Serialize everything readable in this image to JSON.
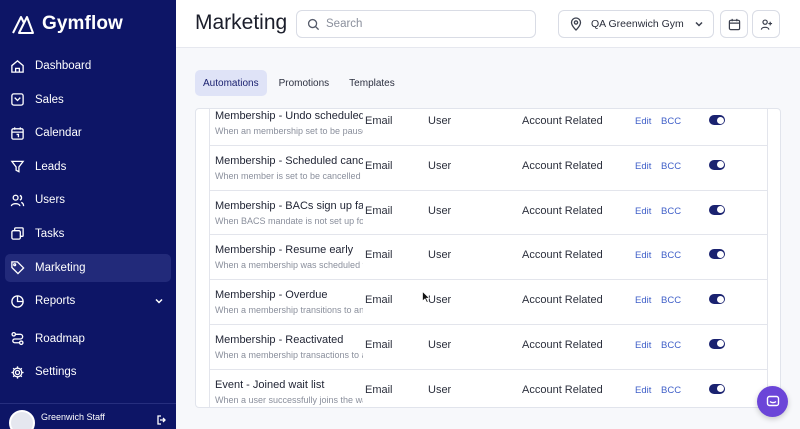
{
  "app": {
    "brand": "Gymflow"
  },
  "sidebar": {
    "items": [
      {
        "label": "Dashboard",
        "icon": "home-icon"
      },
      {
        "label": "Sales",
        "icon": "sales-icon"
      },
      {
        "label": "Calendar",
        "icon": "calendar-icon"
      },
      {
        "label": "Leads",
        "icon": "funnel-icon"
      },
      {
        "label": "Users",
        "icon": "users-icon"
      },
      {
        "label": "Tasks",
        "icon": "tasks-icon"
      },
      {
        "label": "Marketing",
        "icon": "tag-icon",
        "active": true
      },
      {
        "label": "Reports",
        "icon": "pie-chart-icon",
        "expandable": true
      },
      {
        "label": "Roadmap",
        "icon": "route-icon"
      },
      {
        "label": "Settings",
        "icon": "gear-icon"
      }
    ],
    "user": {
      "name": "Greenwich Staff"
    }
  },
  "header": {
    "title": "Marketing",
    "search_placeholder": "Search",
    "gym_selector": "QA Greenwich Gym"
  },
  "tabs": [
    {
      "label": "Automations",
      "active": true
    },
    {
      "label": "Promotions",
      "active": false
    },
    {
      "label": "Templates",
      "active": false
    }
  ],
  "table": {
    "rows": [
      {
        "title": "Membership - Undo scheduled pause",
        "desc": "When an membership set to be paused is reverted",
        "type": "Email",
        "audience": "User",
        "category": "Account Related",
        "edit": "Edit",
        "bcc": "BCC",
        "enabled": true
      },
      {
        "title": "Membership - Scheduled cancellation",
        "desc": "When member is set to be cancelled in the future",
        "type": "Email",
        "audience": "User",
        "category": "Account Related",
        "edit": "Edit",
        "bcc": "BCC",
        "enabled": true
      },
      {
        "title": "Membership - BACs sign up failure",
        "desc": "When BACS mandate is not set up for the membership",
        "type": "Email",
        "audience": "User",
        "category": "Account Related",
        "edit": "Edit",
        "bcc": "BCC",
        "enabled": true
      },
      {
        "title": "Membership - Resume early",
        "desc": "When a membership was scheduled to resume early",
        "type": "Email",
        "audience": "User",
        "category": "Account Related",
        "edit": "Edit",
        "bcc": "BCC",
        "enabled": true
      },
      {
        "title": "Membership - Overdue",
        "desc": "When a membership transitions to an overdue state",
        "type": "Email",
        "audience": "User",
        "category": "Account Related",
        "edit": "Edit",
        "bcc": "BCC",
        "enabled": true
      },
      {
        "title": "Membership - Reactivated",
        "desc": "When a membership transactions to active",
        "type": "Email",
        "audience": "User",
        "category": "Account Related",
        "edit": "Edit",
        "bcc": "BCC",
        "enabled": true
      },
      {
        "title": "Event - Joined wait list",
        "desc": "When a user successfully joins the wait list",
        "type": "Email",
        "audience": "User",
        "category": "Account Related",
        "edit": "Edit",
        "bcc": "BCC",
        "enabled": true
      }
    ]
  },
  "colors": {
    "sidebar_bg": "#0d1566",
    "accent": "#1a2270",
    "link": "#3f5fc8",
    "chat": "#6b45d8"
  }
}
